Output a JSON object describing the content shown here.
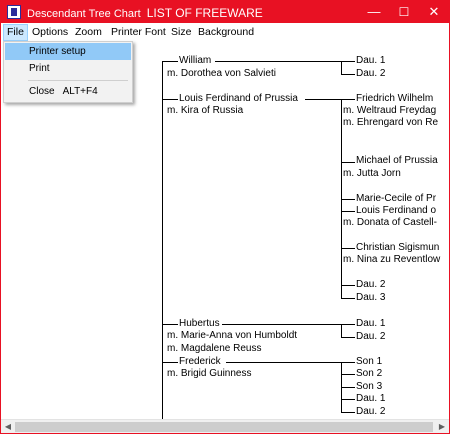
{
  "window": {
    "title_app": "Descendant Tree Chart",
    "title_doc": "LIST OF FREEWARE",
    "controls": {
      "minimize": "—",
      "maximize": "☐",
      "close": "✕"
    },
    "accent_color": "#e81123"
  },
  "menubar": {
    "items": [
      "File",
      "Options",
      "Zoom",
      "Printer Font",
      "Size",
      "Background"
    ],
    "active": "File"
  },
  "file_menu": {
    "printer_setup": "Printer setup",
    "print": "Print",
    "close": "Close",
    "close_shortcut": "ALT+F4"
  },
  "tree": {
    "william": "William",
    "william_spouse": "m. Dorothea von Salvieti",
    "william_children": [
      "Dau. 1",
      "Dau. 2"
    ],
    "louis": "Louis Ferdinand of Prussia",
    "louis_spouse": "m. Kira of Russia",
    "friedrich": "Friedrich Wilhelm",
    "friedrich_spouses": [
      "m. Weltraud Freydag",
      "m. Ehrengard von Re"
    ],
    "michael": "Michael of Prussia",
    "michael_spouse": "m. Jutta Jorn",
    "marie_cecile": "Marie-Cecile of Pr",
    "louis_ferdinand_jr": "Louis Ferdinand o",
    "louis_ferdinand_jr_spouse": "m. Donata of Castell-",
    "christian": "Christian Sigismun",
    "christian_spouse": "m. Nina zu Reventlow",
    "louis_daughters": [
      "Dau. 2",
      "Dau. 3"
    ],
    "hubertus": "Hubertus",
    "hubertus_spouses": [
      "m. Marie-Anna von Humboldt",
      "m. Magdalene Reuss"
    ],
    "hubertus_children": [
      "Dau. 1",
      "Dau. 2"
    ],
    "frederick": "Frederick",
    "frederick_spouse": "m. Brigid Guinness",
    "frederick_children": [
      "Son 1",
      "Son 2",
      "Son 3",
      "Dau. 1",
      "Dau. 2"
    ]
  },
  "scrollbar": {
    "left_arrow": "◀",
    "right_arrow": "▶"
  }
}
